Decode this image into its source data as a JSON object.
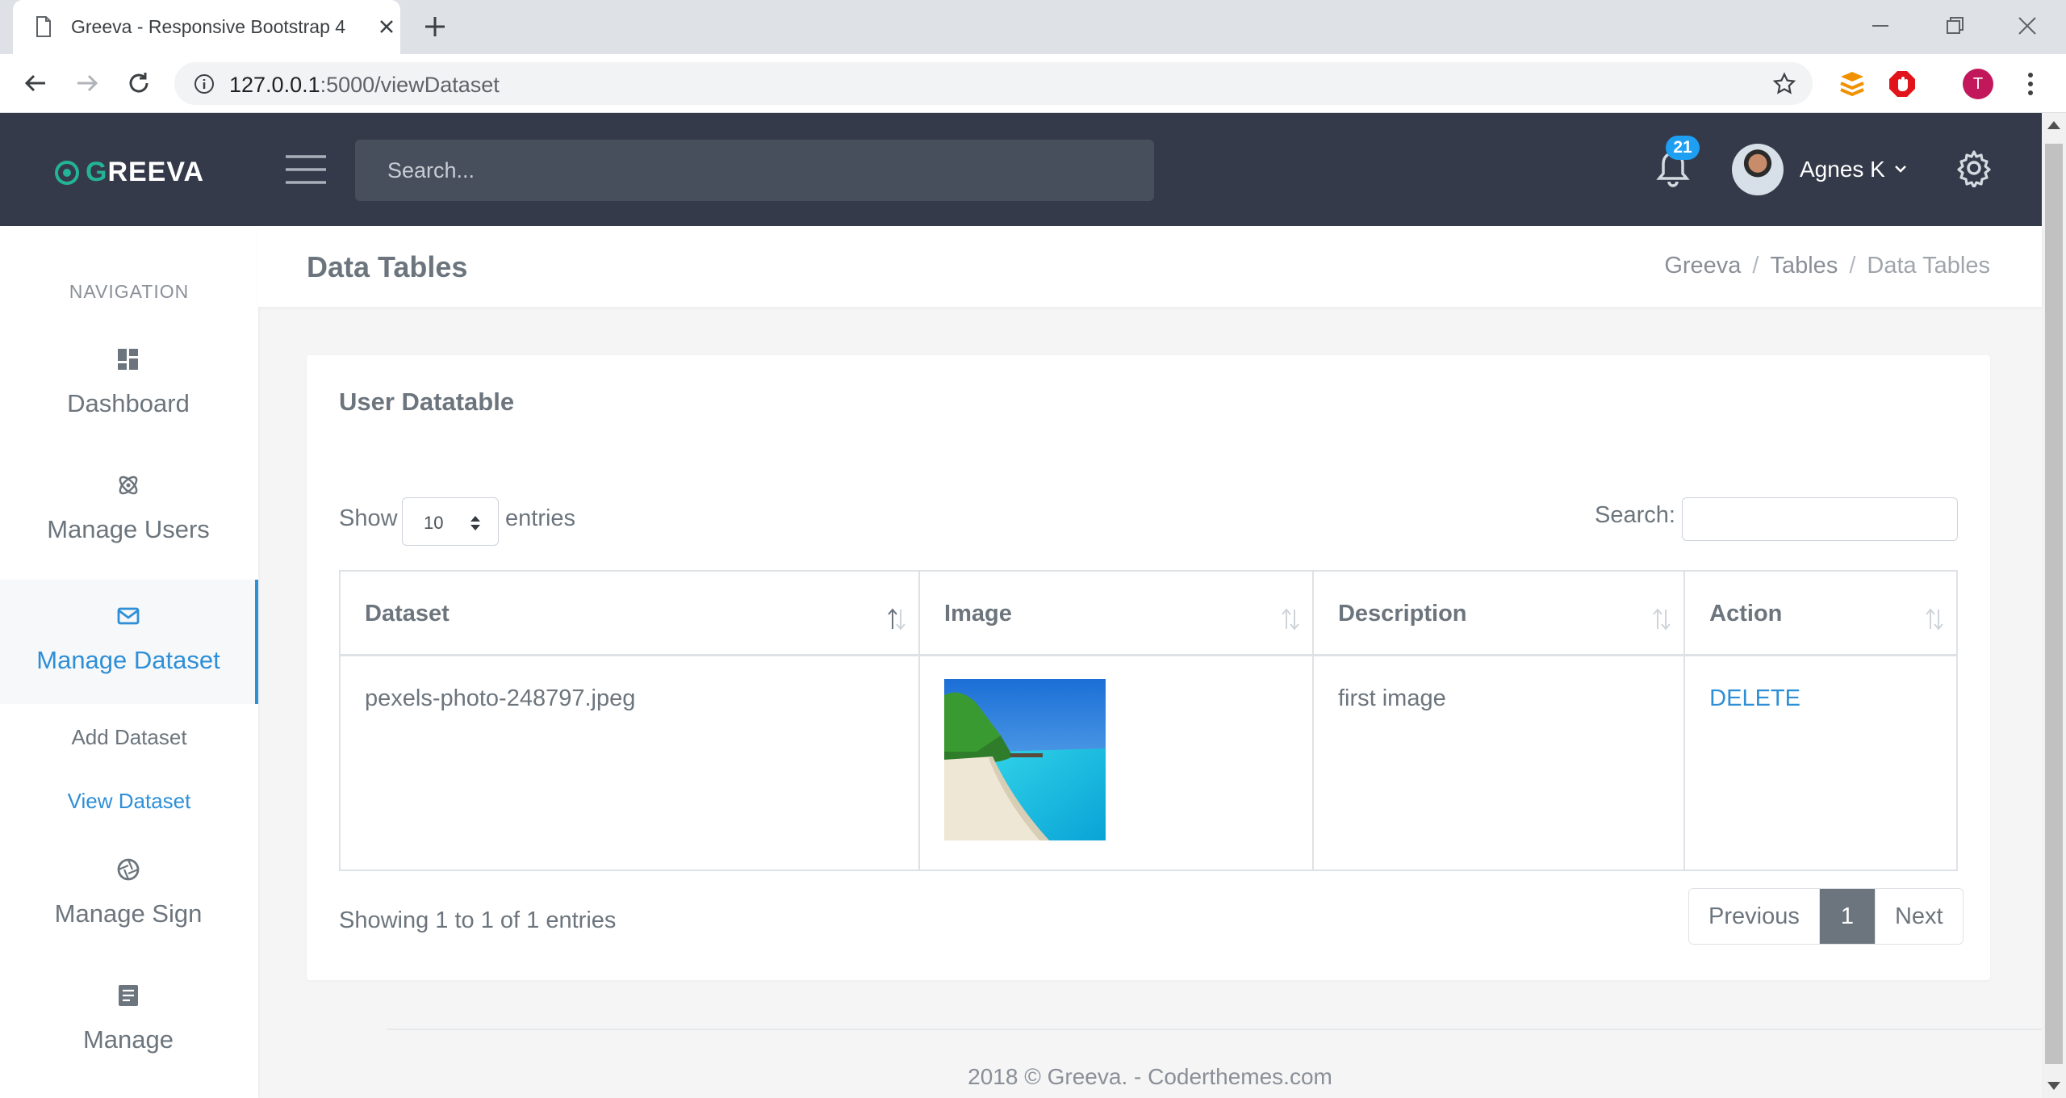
{
  "browser": {
    "tab_title": "Greeva - Responsive Bootstrap 4",
    "url_host": "127.0.0.1",
    "url_path": ":5000/viewDataset",
    "profile_initial": "T"
  },
  "topbar": {
    "logo_first": "G",
    "logo_rest": "REEVA",
    "search_placeholder": "Search...",
    "notification_count": "21",
    "user_name": "Agnes K"
  },
  "sidebar": {
    "title": "NAVIGATION",
    "items": [
      {
        "label": "Dashboard",
        "icon": "dashboard-icon"
      },
      {
        "label": "Manage Users",
        "icon": "atom-icon"
      },
      {
        "label": "Manage Dataset",
        "icon": "envelope-icon",
        "active": true
      },
      {
        "label": "Manage Sign",
        "icon": "aperture-icon"
      },
      {
        "label": "Manage",
        "icon": "document-icon"
      }
    ],
    "sub_items": [
      {
        "label": "Add Dataset"
      },
      {
        "label": "View Dataset",
        "current": true
      }
    ]
  },
  "page": {
    "title": "Data Tables",
    "breadcrumb": [
      "Greeva",
      "Tables",
      "Data Tables"
    ]
  },
  "card": {
    "title": "User Datatable",
    "show_label": "Show",
    "page_length": "10",
    "entries_label": "entries",
    "search_label": "Search:",
    "columns": [
      "Dataset",
      "Image",
      "Description",
      "Action"
    ],
    "rows": [
      {
        "dataset": "pexels-photo-248797.jpeg",
        "description": "first image",
        "action": "DELETE"
      }
    ],
    "info": "Showing 1 to 1 of 1 entries",
    "pagination": {
      "previous": "Previous",
      "current": "1",
      "next": "Next"
    }
  },
  "footer": "2018 © Greeva. - Coderthemes.com"
}
